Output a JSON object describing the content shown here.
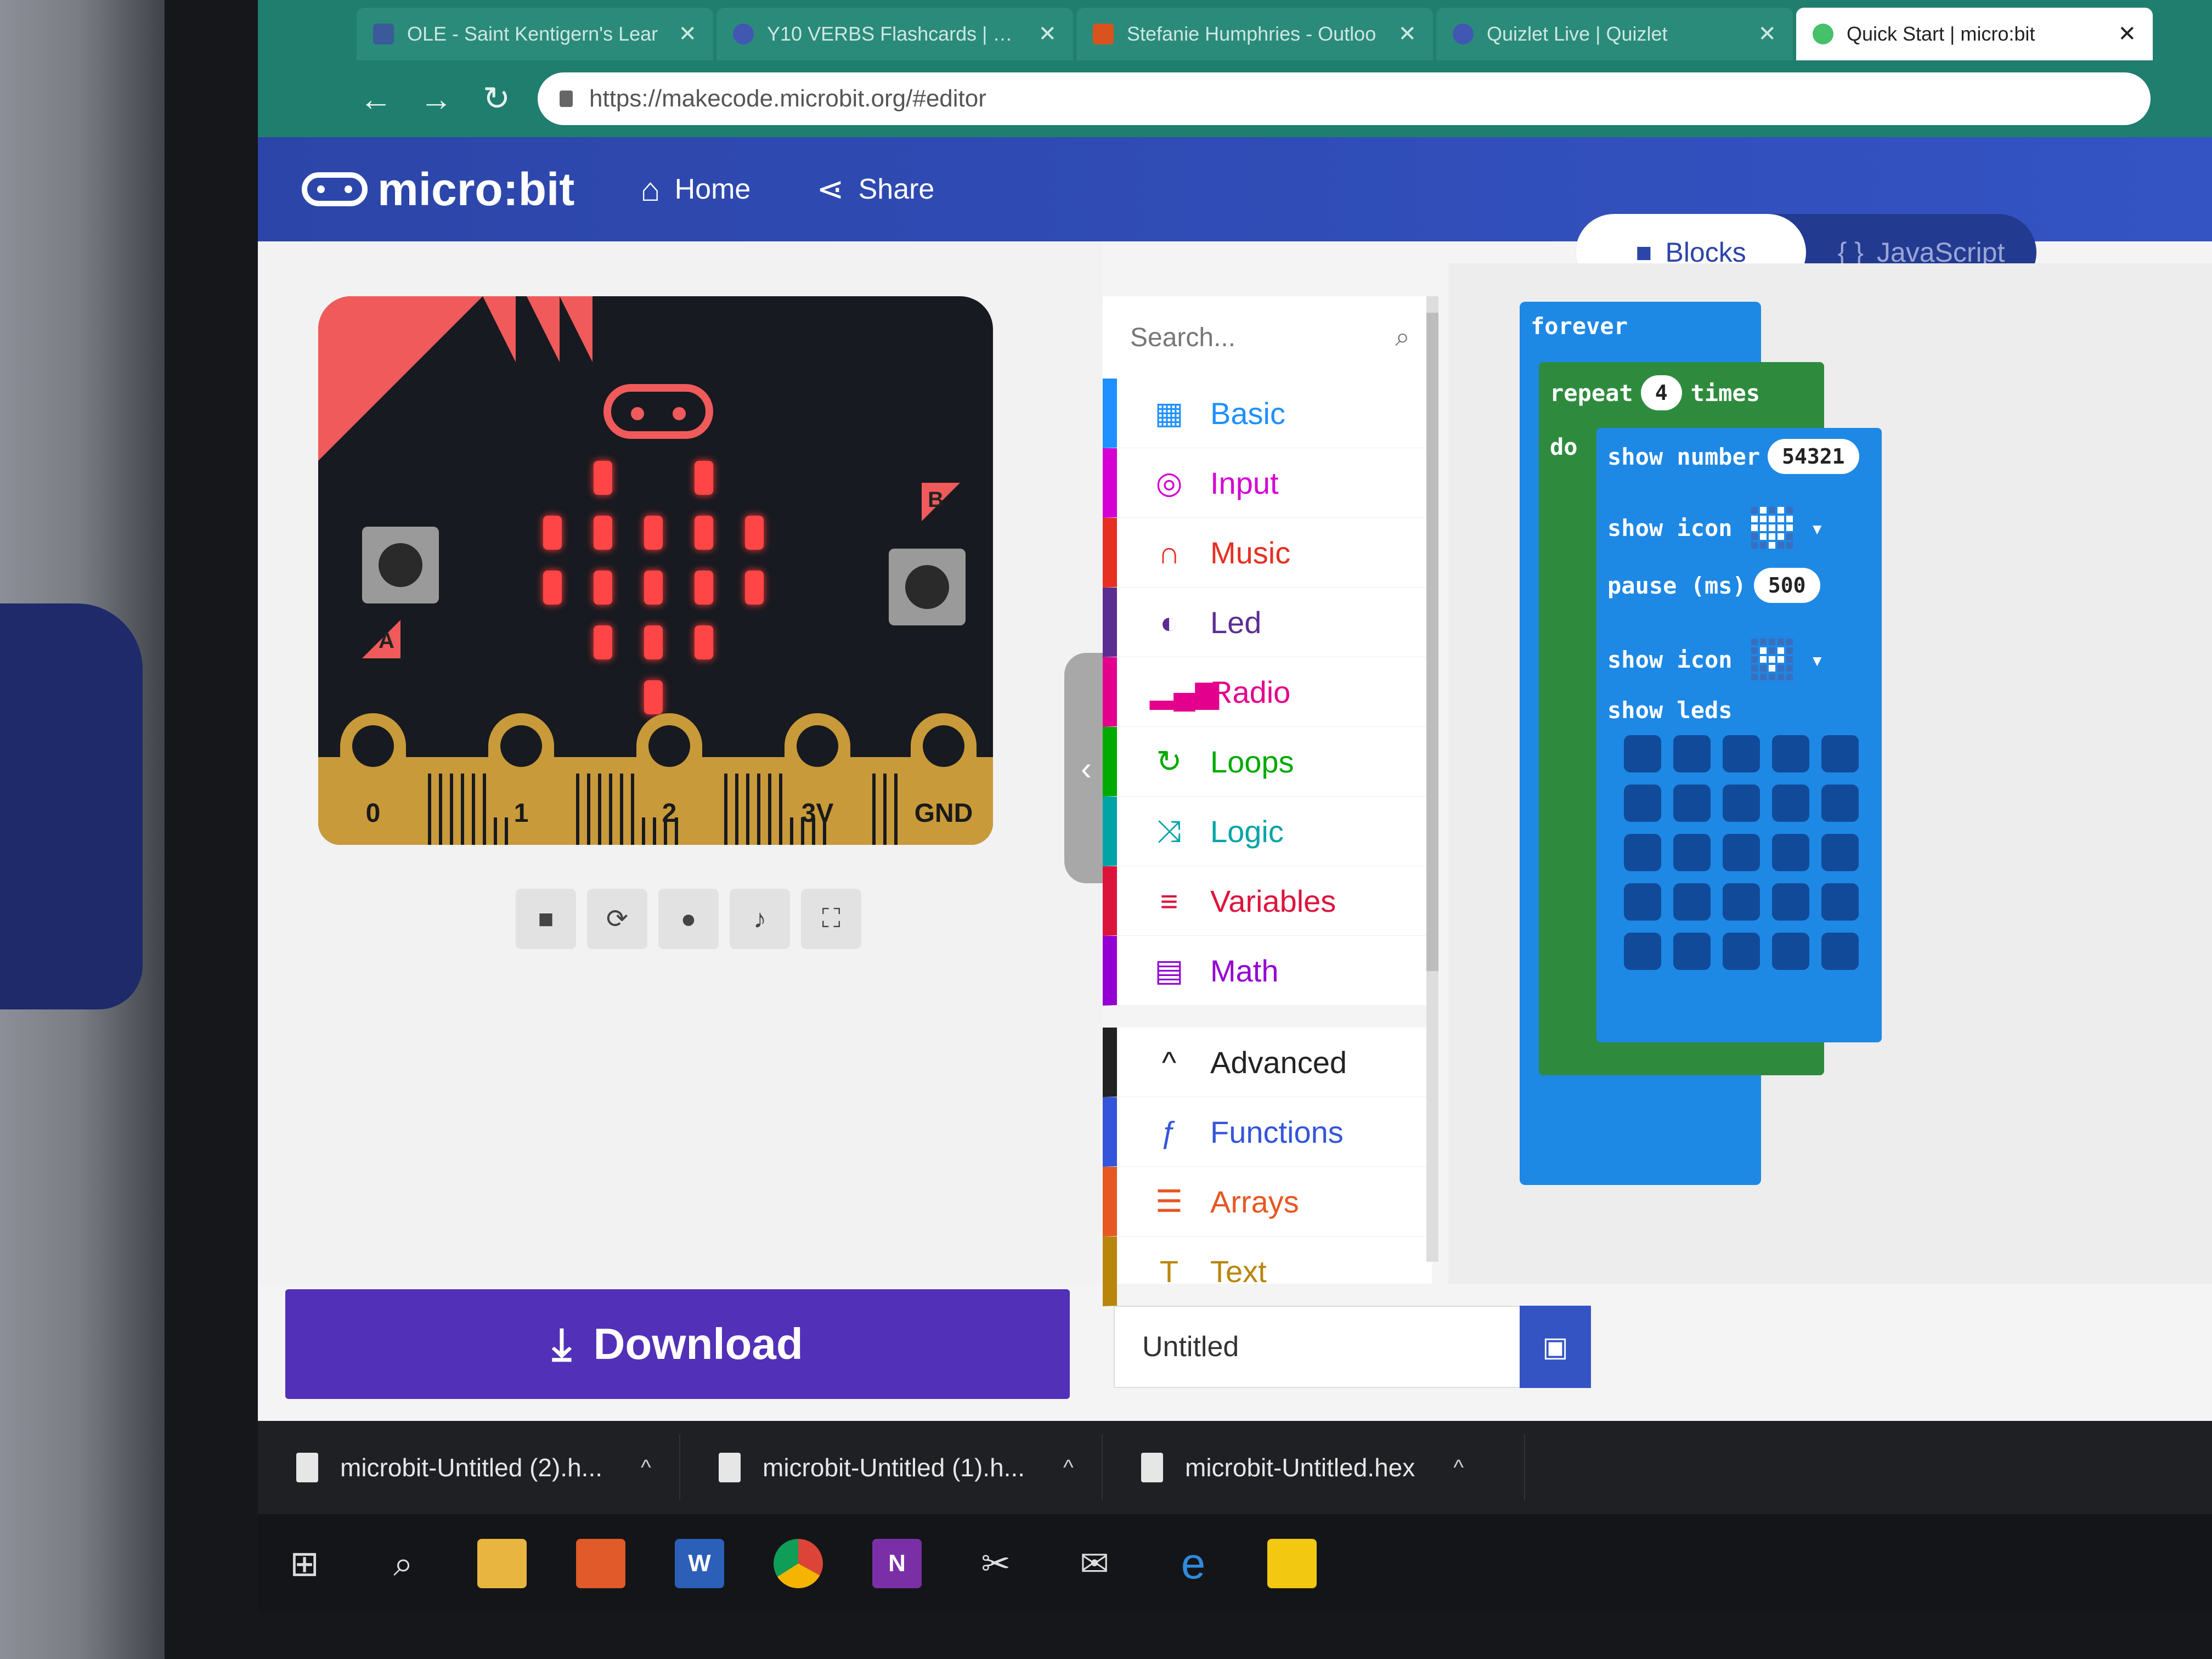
{
  "browser": {
    "tabs": [
      {
        "title": "OLE - Saint Kentigern's Lear",
        "favicon": "ole-icon"
      },
      {
        "title": "Y10 VERBS Flashcards | Quizl",
        "favicon": "quizlet-icon"
      },
      {
        "title": "Stefanie Humphries - Outloo",
        "favicon": "outlook-icon"
      },
      {
        "title": "Quizlet Live | Quizlet",
        "favicon": "quizlet-icon"
      },
      {
        "title": "Quick Start | micro:bit",
        "favicon": "microbit-icon"
      }
    ],
    "url": "https://makecode.microbit.org/#editor",
    "close_glyph": "✕"
  },
  "header": {
    "logo": "micro:bit",
    "home": "Home",
    "share": "Share",
    "mode_blocks": "Blocks",
    "mode_javascript": "JavaScript"
  },
  "simulator": {
    "button_a": "A",
    "button_b": "B",
    "pins": [
      "0",
      "1",
      "2",
      "3V",
      "GND"
    ],
    "controls": [
      "stop-icon",
      "restart-icon",
      "debug-icon",
      "sound-icon",
      "fullscreen-icon"
    ]
  },
  "toolbox": {
    "search_placeholder": "Search...",
    "categories": [
      {
        "label": "Basic",
        "color": "#1e90ff",
        "icon": "grid-icon"
      },
      {
        "label": "Input",
        "color": "#d400d4",
        "icon": "target-icon"
      },
      {
        "label": "Music",
        "color": "#e63022",
        "icon": "headphones-icon"
      },
      {
        "label": "Led",
        "color": "#5c2d91",
        "icon": "toggle-icon"
      },
      {
        "label": "Radio",
        "color": "#e3008c",
        "icon": "signal-bars-icon"
      },
      {
        "label": "Loops",
        "color": "#00aa00",
        "icon": "loop-arrow-icon"
      },
      {
        "label": "Logic",
        "color": "#00a4a6",
        "icon": "shuffle-icon"
      },
      {
        "label": "Variables",
        "color": "#dc143c",
        "icon": "lines-icon"
      },
      {
        "label": "Math",
        "color": "#9400d3",
        "icon": "calculator-icon"
      }
    ],
    "advanced": {
      "label": "Advanced",
      "color": "#222222"
    },
    "advanced_categories": [
      {
        "label": "Functions",
        "color": "#3455db",
        "icon": "function-icon"
      },
      {
        "label": "Arrays",
        "color": "#e65722",
        "icon": "list-icon"
      },
      {
        "label": "Text",
        "color": "#b8860b",
        "icon": "text-icon"
      }
    ]
  },
  "workspace": {
    "forever": "forever",
    "repeat": "repeat",
    "repeat_count": "4",
    "times": "times",
    "do": "do",
    "show_number": "show number",
    "number_value": "54321",
    "show_icon": "show icon",
    "pause": "pause (ms)",
    "pause_value": "500",
    "show_leds": "show leds"
  },
  "footer": {
    "download": "Download",
    "project_name": "Untitled"
  },
  "downloads": [
    {
      "name": "microbit-Untitled (2).h..."
    },
    {
      "name": "microbit-Untitled (1).h..."
    },
    {
      "name": "microbit-Untitled.hex"
    }
  ],
  "taskbar": [
    "windows-start-icon",
    "search-icon",
    "file-explorer-icon",
    "store-icon",
    "word-icon",
    "chrome-icon",
    "onenote-icon",
    "snipping-tool-icon",
    "mail-icon",
    "edge-icon",
    "sticky-notes-icon"
  ]
}
